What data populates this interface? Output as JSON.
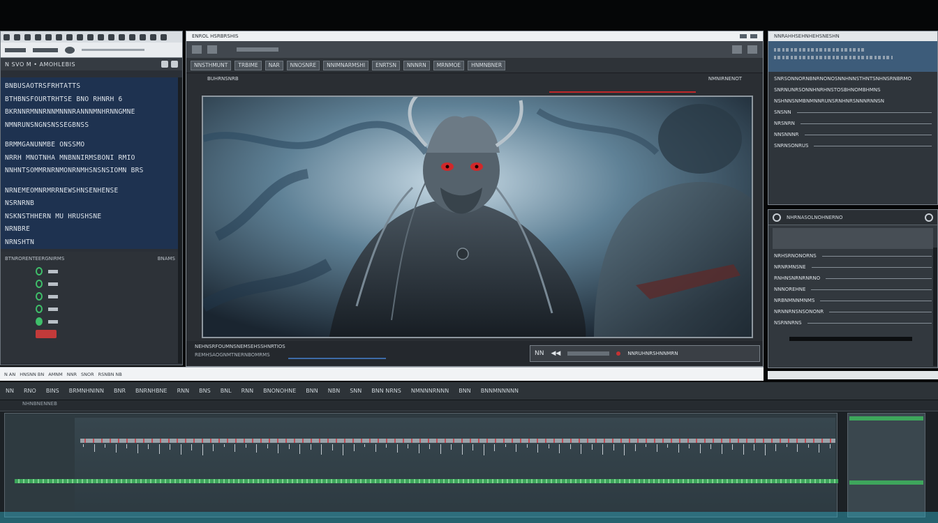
{
  "left_panel": {
    "header_title": "N SVO M • AMOHLEBIS",
    "info_lines": [
      "BNBUSAOTRSFRHTATTS",
      "BTHBNSFOURTRHTSE BNO RHNRH 6",
      "BKRNNRMNNRNNMNNNRANNNMNHRNNGMNE",
      "NMNRUNSNGNSNSSEGBNSS",
      "BRMMGANUNMBE ONSSMO",
      "NRRH MNOTNHA MNBNNIRMSBONI RMIO",
      "NNHNTSOMMRNRNMONRNMHSNSNSIOMN BRS",
      "NRNEMEOMNRMRRNEWSHNSENHENSE",
      "NSRNRNB",
      "NSKNSTHHERN MU HRUSHSNE",
      "NRNBRE",
      "NRNSHTN"
    ],
    "lower_header": "BTNRORENTEERGNIRMS",
    "lower_header_right": "BNAMS"
  },
  "center_panel": {
    "window_title": "ENROL HSRBRSHIS",
    "toolbar": [
      "NNSTHMUNT",
      "TRBIME",
      "NAR",
      "NNOSNRE",
      "NNIMNARMSHI",
      "ENRTSN",
      "NNNRN",
      "MRNMOE",
      "HNMNBNER"
    ],
    "viewer_label": "BUHRNSNRB",
    "viewer_label_right": "NMNIRNENOT",
    "caption_top": "NEHNSRFOUMNSNEMSEHSSHNRTIOS",
    "caption_bottom": "REMHSAOGNMTNERNBOMRMS",
    "transport_labels": [
      "NN",
      "◀◀",
      "NNRUHNRSHNNMRN"
    ]
  },
  "status_bar": [
    "N AN",
    "HNSNN BN",
    "AMNM",
    "NNR",
    "SNOR",
    "RSNBN NB"
  ],
  "right_panel": {
    "top_label": "NNRAHHSEHNHEHSNESHN",
    "lines": [
      "SNRSONNORNBNRNONOSNNHNNSTHNTSNHNSRNBRMO",
      "SNRNUNRSONNHNRHNSTOSBHNOMBHMNS",
      "NSHNNSNMBNMNNRUNSRNHNRSNNNRNNSN",
      "SNSNN",
      "NRSNRN",
      "NNSNNNR",
      "SNRNSONRUS"
    ]
  },
  "right_panel2": {
    "tab_label": "NHRNASOLNOHNERNO",
    "lines": [
      "NRHSRNONORNS",
      "NRNRMNSNE",
      "RNHNSNRNRNRNO",
      "NNNOREHNE",
      "NRBNMNNMNMS",
      "NRNNRNSNSONONR",
      "NSRNNRNS"
    ]
  },
  "timeline": {
    "header_items": [
      "NN",
      "RNO",
      "BINS",
      "BRMNHNINN",
      "BNR",
      "BNRNHBNE",
      "RNN",
      "BNS",
      "BNL",
      "RNN",
      "BNONOHNE",
      "BNN",
      "NBN",
      "SNN",
      "BNN NRNS",
      "NMNNNRNNN",
      "BNN",
      "BNNMNNNNN"
    ],
    "ruler_label": "NHNBNENNEB"
  },
  "colors": {
    "accent_blue": "#1e3250",
    "accent_red": "#c0282a",
    "track_green": "#3ea65c"
  }
}
